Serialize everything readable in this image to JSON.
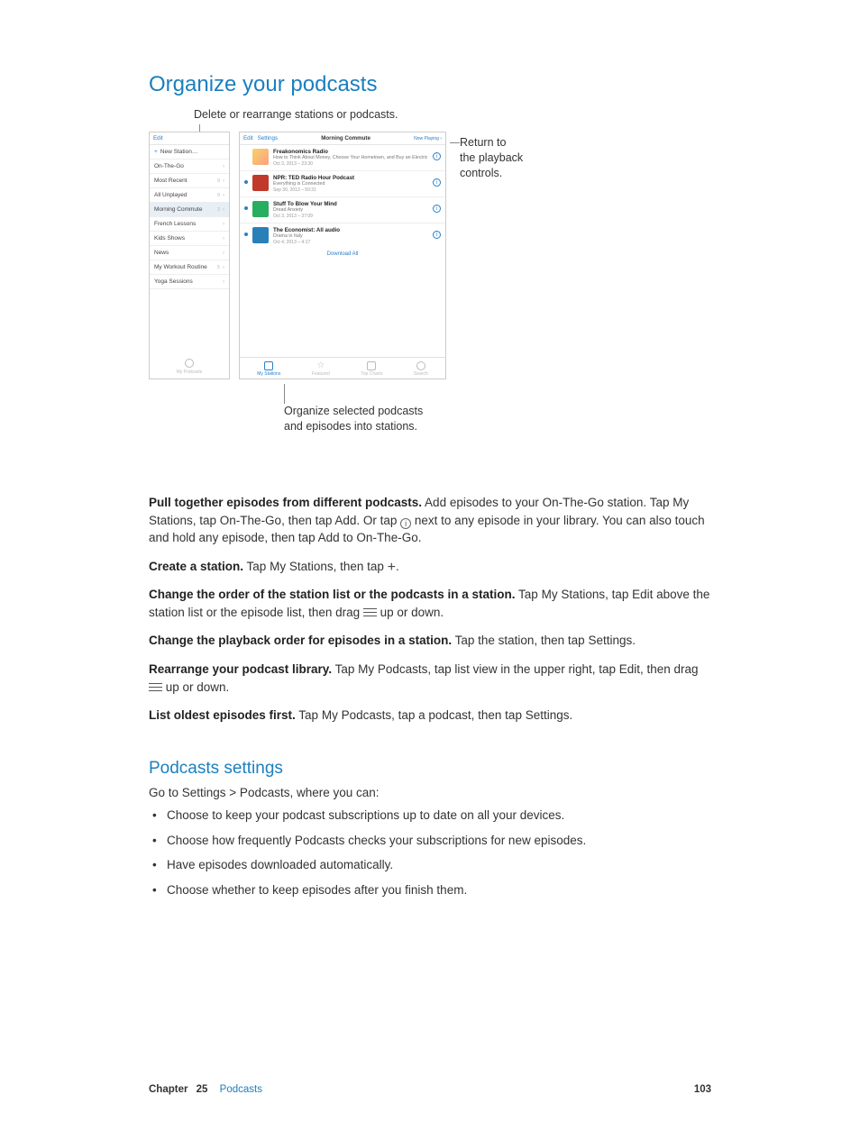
{
  "section1": {
    "title": "Organize your podcasts"
  },
  "callouts": {
    "top": "Delete or rearrange stations or podcasts.",
    "right_l1": "Return to",
    "right_l2": "the playback",
    "right_l3": "controls.",
    "bottom_l1": "Organize selected podcasts",
    "bottom_l2": "and episodes into stations."
  },
  "left": {
    "edit": "Edit",
    "footer": "My Podcasts",
    "rows": [
      {
        "label": "New Station…",
        "plus": "+",
        "chev": ""
      },
      {
        "label": "On-The-Go",
        "count": "",
        "chev": "›"
      },
      {
        "label": "Most Recent",
        "count": "9",
        "chev": "›"
      },
      {
        "label": "All Unplayed",
        "count": "9",
        "chev": "›"
      },
      {
        "label": "Morning Commute",
        "count": "3",
        "chev": "›",
        "sel": true
      },
      {
        "label": "French Lessons",
        "count": "",
        "chev": "›"
      },
      {
        "label": "Kids Shows",
        "count": "",
        "chev": "›"
      },
      {
        "label": "News",
        "count": "",
        "chev": "›"
      },
      {
        "label": "My Workout Routine",
        "count": "5",
        "chev": "›"
      },
      {
        "label": "Yoga Sessions",
        "count": "",
        "chev": "›"
      }
    ]
  },
  "right": {
    "edit": "Edit",
    "settings": "Settings",
    "title": "Morning Commute",
    "now_playing": "Now Playing",
    "download_all": "Download All",
    "episodes": [
      {
        "dot": false,
        "art": "a",
        "title": "Freakonomics Radio",
        "sub": "How to Think About Money, Choose Your Hometown, and Buy an Electric Toothbrush",
        "meta": "Oct 3, 2013 – 23:30"
      },
      {
        "dot": true,
        "art": "b",
        "title": "NPR: TED Radio Hour Podcast",
        "sub": "Everything is Connected",
        "meta": "Sep 30, 2013 – 50:31"
      },
      {
        "dot": true,
        "art": "c",
        "title": "Stuff To Blow Your Mind",
        "sub": "Dread Anxiety",
        "meta": "Oct 3, 2013 – 37:09"
      },
      {
        "dot": true,
        "art": "d",
        "title": "The Economist: All audio",
        "sub": "Drama in Italy",
        "meta": "Oct 4, 2013 – 4:17"
      }
    ],
    "tabs": {
      "my_stations": "My Stations",
      "featured": "Featured",
      "top_charts": "Top Charts",
      "search": "Search"
    }
  },
  "body": {
    "p1_bold": "Pull together episodes from different podcasts.",
    "p1_a": " Add episodes to your On-The-Go station. Tap My Stations, tap On-The-Go, then tap Add. Or tap ",
    "p1_b": " next to any episode in your library. You can also touch and hold any episode, then tap Add to On-The-Go.",
    "p2_bold": "Create a station.",
    "p2": " Tap My Stations, then tap ",
    "p2_end": ".",
    "p3_bold": "Change the order of the station list or the podcasts in a station.",
    "p3_a": " Tap My Stations, tap Edit above the station list or the episode list, then drag ",
    "p3_b": " up or down.",
    "p4_bold": "Change the playback order for episodes in a station.",
    "p4": " Tap the station, then tap Settings.",
    "p5_bold": "Rearrange your podcast library.",
    "p5_a": " Tap My Podcasts, tap list view in the upper right, tap Edit, then drag ",
    "p5_b": " up or down.",
    "p6_bold": "List oldest episodes first.",
    "p6": " Tap My Podcasts, tap a podcast, then tap Settings."
  },
  "section2": {
    "title": "Podcasts settings",
    "intro": "Go to Settings > Podcasts, where you can:",
    "items": [
      "Choose to keep your podcast subscriptions up to date on all your devices.",
      "Choose how frequently Podcasts checks your subscriptions for new episodes.",
      "Have episodes downloaded automatically.",
      "Choose whether to keep episodes after you finish them."
    ]
  },
  "footer": {
    "chapter_word": "Chapter",
    "chapter_num": "25",
    "chapter_name": "Podcasts",
    "page_num": "103"
  }
}
